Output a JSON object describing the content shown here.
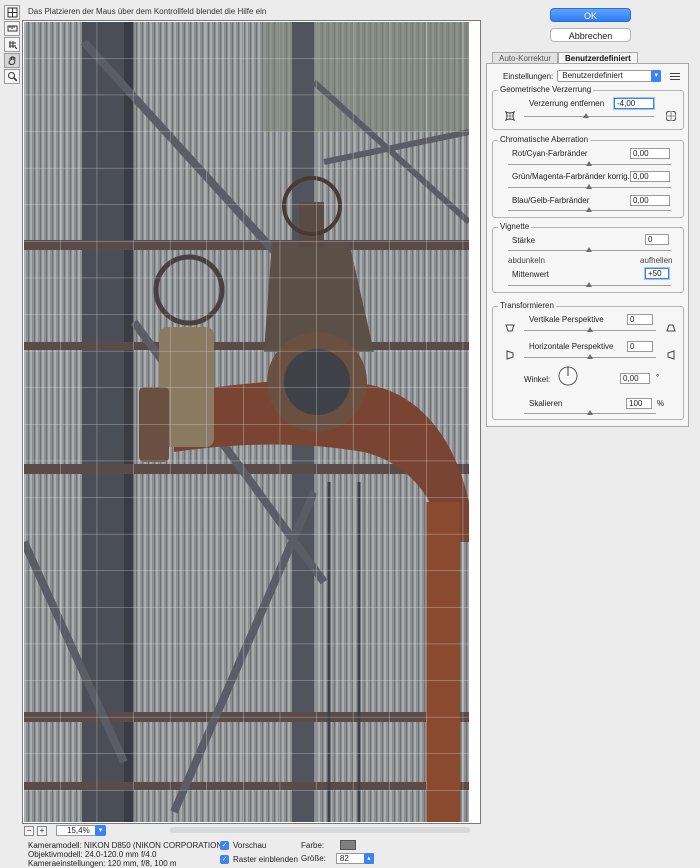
{
  "hint": "Das Platzieren der Maus über dem Kontrollfeld blendet die Hilfe ein",
  "tools": [
    {
      "name": "remove-distortion-icon"
    },
    {
      "name": "straighten-icon"
    },
    {
      "name": "move-grid-icon"
    },
    {
      "name": "hand-icon"
    },
    {
      "name": "zoom-icon"
    }
  ],
  "buttons": {
    "ok": "OK",
    "cancel": "Abbrechen"
  },
  "tabs": [
    "Auto-Korrektur",
    "Benutzerdefiniert"
  ],
  "settings": {
    "label": "Einstellungen:",
    "value": "Benutzerdefiniert"
  },
  "geo": {
    "title": "Geometrische Verzerrung",
    "label": "Verzerrung entfernen",
    "value": "-4,00",
    "level": 0.48
  },
  "chrom": {
    "title": "Chromatische Aberration",
    "rows": [
      {
        "label": "Rot/Cyan-Farbränder",
        "value": "0,00"
      },
      {
        "label": "Grün/Magenta-Farbränder korrig.",
        "value": "0,00"
      },
      {
        "label": "Blau/Gelb-Farbränder",
        "value": "0,00"
      }
    ]
  },
  "vignette": {
    "title": "Vignette",
    "amount_label": "Stärke",
    "amount_value": "0",
    "darken": "abdunkeln",
    "lighten": "aufhellen",
    "mid_label": "Mittenwert",
    "mid_value": "+50"
  },
  "transform": {
    "title": "Transformieren",
    "vert_label": "Vertikale Perspektive",
    "vert_value": "0",
    "horiz_label": "Horizontale Perspektive",
    "horiz_value": "0",
    "angle_label": "Winkel:",
    "angle_value": "0,00",
    "angle_unit": "°",
    "scale_label": "Skalieren",
    "scale_value": "100",
    "scale_unit": "%"
  },
  "zoom": {
    "minus": "−",
    "plus": "+",
    "value": "15,4%"
  },
  "camera": {
    "model": "Kameramodell: NIKON D850 (NIKON CORPORATION)",
    "lens": "Objektivmodell: 24.0-120.0 mm f/4.0",
    "settings": "Kameraeinstellungen: 120 mm, f/8, 100 m"
  },
  "options": {
    "preview": "Vorschau",
    "grid": "Raster einblenden",
    "color_label": "Farbe:",
    "size_label": "Größe:",
    "size_value": "82"
  },
  "colors": {
    "accent": "#3b82f6",
    "grid_color": "#7f7f7f"
  }
}
